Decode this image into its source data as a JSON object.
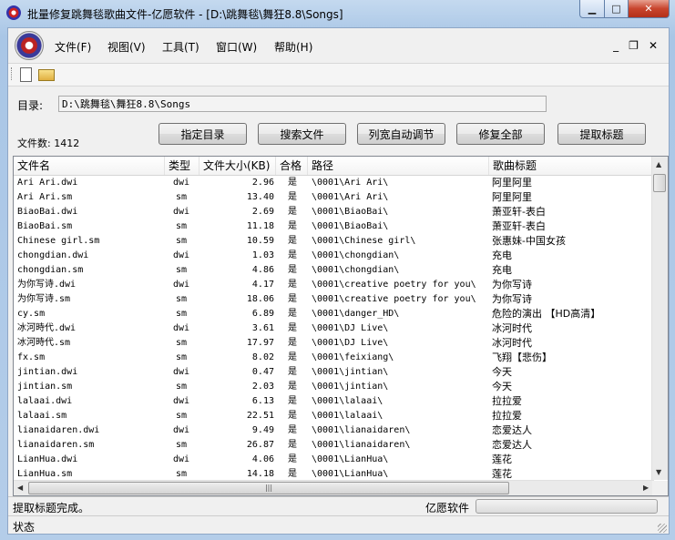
{
  "window": {
    "title": "批量修复跳舞毯歌曲文件-亿愿软件 - [D:\\跳舞毯\\舞狂8.8\\Songs]",
    "minimize_glyph": "▁",
    "maximize_glyph": "□",
    "close_glyph": "✕"
  },
  "menu": {
    "items": [
      "文件(F)",
      "视图(V)",
      "工具(T)",
      "窗口(W)",
      "帮助(H)"
    ],
    "mdi_minimize": "_",
    "mdi_restore": "❐",
    "mdi_close": "✕"
  },
  "toolbar": {
    "new_icon": "new-file-icon",
    "open_icon": "open-folder-icon"
  },
  "directory": {
    "label": "目录:",
    "value": "D:\\跳舞毯\\舞狂8.8\\Songs"
  },
  "file_count": "文件数: 1412",
  "buttons": {
    "set_dir": "指定目录",
    "search": "搜索文件",
    "auto_width": "列宽自动调节",
    "fix_all": "修复全部",
    "extract_titles": "提取标题"
  },
  "table": {
    "columns": [
      "文件名",
      "类型",
      "文件大小(KB)",
      "合格",
      "路径",
      "歌曲标题"
    ],
    "rows": [
      [
        "Ari Ari.dwi",
        "dwi",
        "2.96",
        "是",
        "\\0001\\Ari Ari\\",
        "阿里阿里"
      ],
      [
        "Ari Ari.sm",
        "sm",
        "13.40",
        "是",
        "\\0001\\Ari Ari\\",
        "阿里阿里"
      ],
      [
        "BiaoBai.dwi",
        "dwi",
        "2.69",
        "是",
        "\\0001\\BiaoBai\\",
        "萧亚轩-表白"
      ],
      [
        "BiaoBai.sm",
        "sm",
        "11.18",
        "是",
        "\\0001\\BiaoBai\\",
        "萧亚轩-表白"
      ],
      [
        "Chinese girl.sm",
        "sm",
        "10.59",
        "是",
        "\\0001\\Chinese girl\\",
        "张惠妹-中国女孩"
      ],
      [
        "chongdian.dwi",
        "dwi",
        "1.03",
        "是",
        "\\0001\\chongdian\\",
        "充电"
      ],
      [
        "chongdian.sm",
        "sm",
        "4.86",
        "是",
        "\\0001\\chongdian\\",
        "充电"
      ],
      [
        "为你写诗.dwi",
        "dwi",
        "4.17",
        "是",
        "\\0001\\creative poetry for you\\",
        "为你写诗"
      ],
      [
        "为你写诗.sm",
        "sm",
        "18.06",
        "是",
        "\\0001\\creative poetry for you\\",
        "为你写诗"
      ],
      [
        "cy.sm",
        "sm",
        "6.89",
        "是",
        "\\0001\\danger_HD\\",
        "危险的演出 【HD高清】"
      ],
      [
        "冰河時代.dwi",
        "dwi",
        "3.61",
        "是",
        "\\0001\\DJ Live\\",
        "冰河时代"
      ],
      [
        "冰河時代.sm",
        "sm",
        "17.97",
        "是",
        "\\0001\\DJ Live\\",
        "冰河时代"
      ],
      [
        "fx.sm",
        "sm",
        "8.02",
        "是",
        "\\0001\\feixiang\\",
        "飞翔【悲伤】"
      ],
      [
        "jintian.dwi",
        "dwi",
        "0.47",
        "是",
        "\\0001\\jintian\\",
        "今天"
      ],
      [
        "jintian.sm",
        "sm",
        "2.03",
        "是",
        "\\0001\\jintian\\",
        "今天"
      ],
      [
        "lalaai.dwi",
        "dwi",
        "6.13",
        "是",
        "\\0001\\lalaai\\",
        "拉拉爱"
      ],
      [
        "lalaai.sm",
        "sm",
        "22.51",
        "是",
        "\\0001\\lalaai\\",
        "拉拉爱"
      ],
      [
        "lianaidaren.dwi",
        "dwi",
        "9.49",
        "是",
        "\\0001\\lianaidaren\\",
        "恋爱达人"
      ],
      [
        "lianaidaren.sm",
        "sm",
        "26.87",
        "是",
        "\\0001\\lianaidaren\\",
        "恋爱达人"
      ],
      [
        "LianHua.dwi",
        "dwi",
        "4.06",
        "是",
        "\\0001\\LianHua\\",
        "莲花"
      ],
      [
        "LianHua.sm",
        "sm",
        "14.18",
        "是",
        "\\0001\\LianHua\\",
        "莲花"
      ]
    ]
  },
  "status": {
    "message": "提取标题完成。",
    "brand": "亿愿软件",
    "state": "状态"
  }
}
